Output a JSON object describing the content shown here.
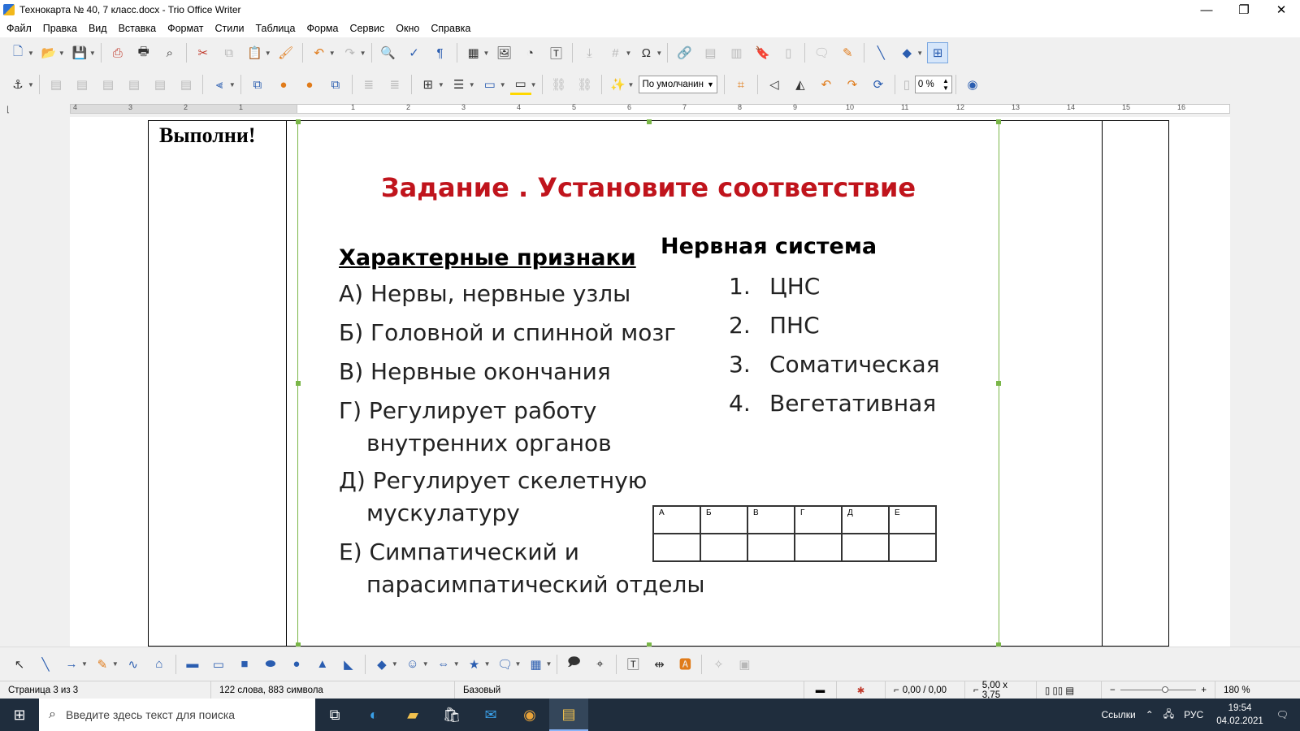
{
  "window": {
    "title": "Технокарта № 40, 7 класс.docx - Trio Office Writer",
    "minimize": "—",
    "restore": "❐",
    "close": "✕"
  },
  "menu": [
    "Файл",
    "Правка",
    "Вид",
    "Вставка",
    "Формат",
    "Стили",
    "Таблица",
    "Форма",
    "Сервис",
    "Окно",
    "Справка"
  ],
  "toolbar2": {
    "style_select": "По умолчанин",
    "transparency": "0 %"
  },
  "ruler": {
    "numbers": [
      "4",
      "3",
      "2",
      "1",
      "1",
      "2",
      "3",
      "4",
      "5",
      "6",
      "7",
      "8",
      "9",
      "10",
      "11",
      "12",
      "13",
      "14",
      "15",
      "16"
    ]
  },
  "document": {
    "left_label": "Выполни!",
    "slide": {
      "title": "Задание . Установите соответствие",
      "left_heading": "Характерные признаки",
      "right_heading": "Нервная система",
      "features": [
        {
          "line1": "А)  Нервы, нервные узлы",
          "line2": ""
        },
        {
          "line1": "Б) Головной и спинной мозг",
          "line2": ""
        },
        {
          "line1": "В)  Нервные окончания",
          "line2": ""
        },
        {
          "line1": "Г)  Регулирует работу",
          "line2": "внутренних органов"
        },
        {
          "line1": "Д) Регулирует  скелетную",
          "line2": "мускулатуру"
        },
        {
          "line1": "Е) Симпатический и",
          "line2": "парасимпатический отделы"
        }
      ],
      "systems": [
        {
          "num": "1.",
          "label": "ЦНС"
        },
        {
          "num": "2.",
          "label": "ПНС"
        },
        {
          "num": "3.",
          "label": "Соматическая"
        },
        {
          "num": "4.",
          "label": "Вегетативная"
        }
      ],
      "answer_table_headers": [
        "А",
        "Б",
        "В",
        "Г",
        "Д",
        "Е"
      ]
    }
  },
  "statusbar": {
    "page": "Страница 3 из 3",
    "words": "122 слова, 883 символа",
    "style": "Базовый",
    "position": "0,00 / 0,00",
    "size": "5,00 x 3,75",
    "zoom": "180 %"
  },
  "taskbar": {
    "search_placeholder": "Введите здесь текст для поиска",
    "links": "Ссылки",
    "lang": "РУС",
    "time": "19:54",
    "date": "04.02.2021"
  }
}
